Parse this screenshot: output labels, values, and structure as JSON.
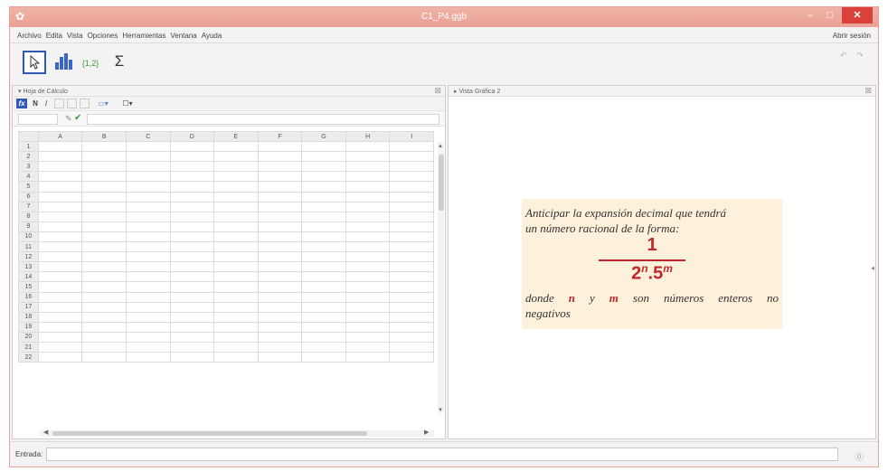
{
  "window": {
    "title": "C1_P4.ggb",
    "app_icon": "geogebra-icon",
    "controls": {
      "minimize": "–",
      "maximize": "□",
      "close": "✕"
    }
  },
  "menubar": {
    "items": [
      "Archivo",
      "Edita",
      "Vista",
      "Opciones",
      "Herramientas",
      "Ventana",
      "Ayuda"
    ],
    "signin": "Abrir sesión"
  },
  "toolbar": {
    "tools": [
      {
        "name": "move",
        "icon": "arrow-cursor-icon",
        "glyph": "⇱"
      },
      {
        "name": "one-variable-analysis",
        "icon": "bar-chart-icon",
        "glyph": ""
      },
      {
        "name": "create-list",
        "icon": "list-icon",
        "glyph": "{1,2}"
      },
      {
        "name": "sum",
        "icon": "sigma-icon",
        "glyph": "Σ"
      }
    ],
    "undo": "↶",
    "redo": "↷"
  },
  "spreadsheet": {
    "title": "▾ Hoja de Cálculo",
    "close": "⊠",
    "format": {
      "fx": "fx",
      "bold": "N",
      "italic": "I",
      "color": "▭▾",
      "border": "☐▾"
    },
    "formula": {
      "pencil": "✎",
      "check": "✔",
      "cellref": "",
      "value": ""
    },
    "columns": [
      "A",
      "B",
      "C",
      "D",
      "E",
      "F",
      "G",
      "H",
      "I"
    ],
    "rows": [
      "1",
      "2",
      "3",
      "4",
      "5",
      "6",
      "7",
      "8",
      "9",
      "10",
      "11",
      "12",
      "13",
      "14",
      "15",
      "16",
      "17",
      "18",
      "19",
      "20",
      "21",
      "22"
    ],
    "scroll": {
      "up": "▲",
      "down": "▼",
      "left": "◀",
      "right": "▶"
    }
  },
  "graphics": {
    "title": "▸ Vista Gráfica 2",
    "close": "⊠",
    "side_arrow": "◂",
    "text": {
      "line1": "Anticipar la expansión decimal que tendrá",
      "line2": "un número racional de la forma:",
      "numerator": "1",
      "den_base1": "2",
      "den_exp1": "n",
      "den_sep": ".",
      "den_base2": "5",
      "den_exp2": "m",
      "line3_a": "donde",
      "line3_n": "n",
      "line3_b": "y",
      "line3_m": "m",
      "line3_c": "son números enteros no",
      "line4": "negativos"
    }
  },
  "input_bar": {
    "label": "Entrada:",
    "value": "",
    "help": "⓪"
  },
  "colors": {
    "titlebar": "#e9a194",
    "accent": "#2f58b8",
    "math_red": "#c0262b",
    "box_bg": "#fdf1db"
  }
}
